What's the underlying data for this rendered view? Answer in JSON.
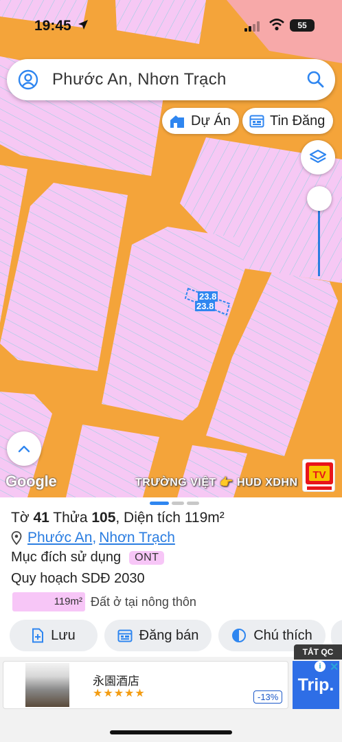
{
  "status_bar": {
    "time": "19:45",
    "battery": "55"
  },
  "search": {
    "text": "Phước An, Nhơn Trạch"
  },
  "chips": {
    "du_an": "Dự Án",
    "tin_dang": "Tin Đăng"
  },
  "map": {
    "parcel_width_label": "23.8",
    "parcel_length_label": "23.8",
    "google_logo": "Google",
    "watermark": "TRƯỜNG VIỆT 👉 HUD XDHN",
    "tv_logo_text": "TV"
  },
  "panel": {
    "title_prefix": "Tờ ",
    "sheet_no": "41",
    "title_mid": " Thửa ",
    "lot_no": "105",
    "title_suffix": ", Diện tích 119m²",
    "ward": "Phước An",
    "district": "Nhơn Trạch",
    "use_label": "Mục đích sử dụng",
    "use_code": "ONT",
    "plan_title": "Quy hoạch SDĐ 2030",
    "plan_area": "119m²",
    "plan_desc": "Đất ở tại nông thôn",
    "actions": {
      "save": "Lưu",
      "post": "Đăng bán",
      "legend": "Chú thích"
    }
  },
  "ad": {
    "close_label": "TẮT QC",
    "name": "永園酒店",
    "stars": "★★★★★",
    "discount": "-13%",
    "brand": "Trip."
  },
  "colors": {
    "road": "#f4a43a",
    "parcel": "#f6c8f4",
    "lot_line": "#8fd0e0",
    "accent": "#2f86f0",
    "corner_pink": "#f7a9a9"
  }
}
